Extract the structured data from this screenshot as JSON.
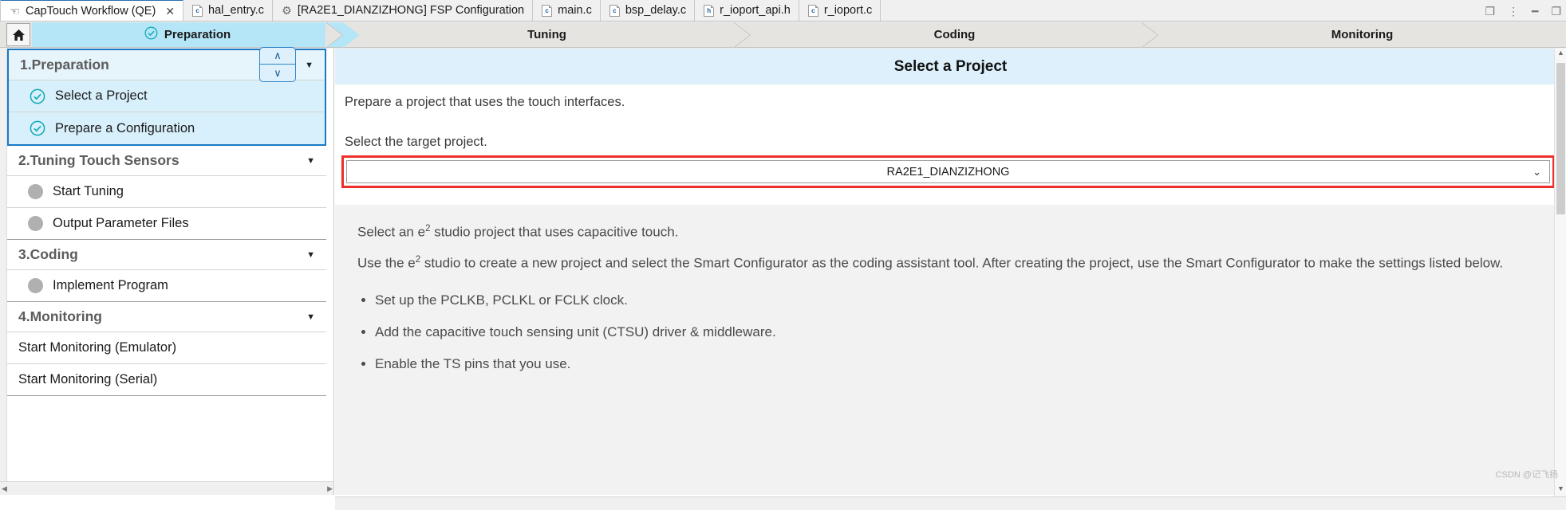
{
  "window": {
    "controls": [
      {
        "name": "restore-perspective-icon",
        "glyph": "❐"
      },
      {
        "name": "more-options-icon",
        "glyph": "⋮"
      },
      {
        "name": "minimize-icon",
        "glyph": "━"
      },
      {
        "name": "maximize-icon",
        "glyph": "❐"
      }
    ]
  },
  "tabs": [
    {
      "label": "CapTouch Workflow (QE)",
      "icon": "hand-pointer-icon",
      "icon_glyph": "☚",
      "type": "hand",
      "active": true,
      "closable": true,
      "close_glyph": "✕"
    },
    {
      "label": "hal_entry.c",
      "icon": "c-file-icon",
      "icon_glyph": "c",
      "type": "file",
      "active": false,
      "closable": false
    },
    {
      "label": "[RA2E1_DIANZIZHONG] FSP Configuration",
      "icon": "gear-icon",
      "icon_glyph": "⚙",
      "type": "gear",
      "active": false,
      "closable": false
    },
    {
      "label": "main.c",
      "icon": "c-file-icon",
      "icon_glyph": "c",
      "type": "file",
      "active": false,
      "closable": false
    },
    {
      "label": "bsp_delay.c",
      "icon": "c-file-icon",
      "icon_glyph": "c",
      "type": "file",
      "active": false,
      "closable": false
    },
    {
      "label": "r_ioport_api.h",
      "icon": "h-file-icon",
      "icon_glyph": "h",
      "type": "file",
      "active": false,
      "closable": false
    },
    {
      "label": "r_ioport.c",
      "icon": "c-file-icon",
      "icon_glyph": "c",
      "type": "file",
      "active": false,
      "closable": false
    }
  ],
  "workflow": {
    "home_button": "home-icon",
    "check_glyph": "✓",
    "steps": [
      {
        "label": "Preparation",
        "active": true,
        "checked": true
      },
      {
        "label": "Tuning",
        "active": false,
        "checked": false
      },
      {
        "label": "Coding",
        "active": false,
        "checked": false
      },
      {
        "label": "Monitoring",
        "active": false,
        "checked": false
      }
    ]
  },
  "sidebar": {
    "caret_glyph": "▼",
    "groups": [
      {
        "title": "1.Preparation",
        "selected": true,
        "collapsible": true,
        "items": [
          {
            "label": "Select a Project",
            "status": "done",
            "bullet": "check-circle-icon"
          },
          {
            "label": "Prepare a Configuration",
            "status": "done",
            "bullet": "check-circle-icon"
          }
        ]
      },
      {
        "title": "2.Tuning Touch Sensors",
        "selected": false,
        "collapsible": true,
        "items": [
          {
            "label": "Start Tuning",
            "status": "pending",
            "bullet": "gray-dot-icon"
          },
          {
            "label": "Output Parameter Files",
            "status": "pending",
            "bullet": "gray-dot-icon"
          }
        ]
      },
      {
        "title": "3.Coding",
        "selected": false,
        "collapsible": true,
        "items": [
          {
            "label": "Implement Program",
            "status": "pending",
            "bullet": "gray-dot-icon"
          }
        ]
      },
      {
        "title": "4.Monitoring",
        "selected": false,
        "collapsible": true,
        "items": [
          {
            "label": "Start Monitoring (Emulator)",
            "status": "none",
            "bullet": "none"
          },
          {
            "label": "Start Monitoring (Serial)",
            "status": "none",
            "bullet": "none"
          }
        ]
      }
    ]
  },
  "content": {
    "title": "Select a Project",
    "nav_up_glyph": "∧",
    "nav_down_glyph": "∨",
    "intro": "Prepare a project that uses the touch interfaces.",
    "select_label": "Select the target project.",
    "project_combo": {
      "value": "RA2E1_DIANZIZHONG",
      "chevron_glyph": "⌄",
      "highlight_color": "#ec2f2a"
    },
    "description": {
      "line1_pre": "Select an e",
      "line1_sup": "2",
      "line1_post": " studio project that uses capacitive touch.",
      "line2_pre": "Use the e",
      "line2_sup": "2",
      "line2_post": " studio to create a new project and select the Smart Configurator as the coding assistant tool. After creating the project, use the Smart Configurator to make the settings listed below.",
      "bullets": [
        "Set up the PCLKB, PCLKL or FCLK clock.",
        "Add the capacitive touch sensing unit (CTSU) driver & middleware.",
        "Enable the TS pins that you use."
      ]
    }
  },
  "scrollbars": {
    "left_arrow_glyph": "◀",
    "right_arrow_glyph": "▶",
    "up_arrow_glyph": "▲",
    "down_arrow_glyph": "▼"
  },
  "watermark": "CSDN @记飞扬",
  "colors": {
    "accent_blue": "#1b79c4",
    "active_step": "#b5e6f7",
    "panel_head": "#ddf0fb",
    "highlight_red": "#ec2f2a"
  }
}
